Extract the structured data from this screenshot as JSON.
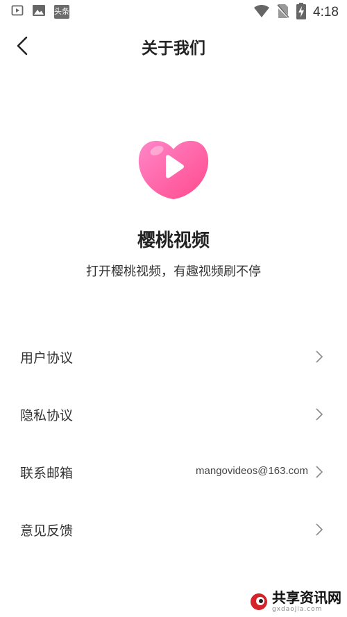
{
  "status_bar": {
    "time": "4:18",
    "left_icons": [
      "play-notification-icon",
      "image-notification-icon",
      "toutiao-notification-icon"
    ],
    "toutiao_label": "头条",
    "right_icons": [
      "wifi-icon",
      "no-sim-icon",
      "battery-charging-icon"
    ]
  },
  "header": {
    "title": "关于我们",
    "back_icon": "chevron-left-icon"
  },
  "app": {
    "name": "樱桃视频",
    "slogan": "打开樱桃视频，有趣视频刷不停",
    "logo_colors": [
      "#ff7fbf",
      "#ff4f95"
    ]
  },
  "menu": {
    "items": [
      {
        "label": "用户协议",
        "value": ""
      },
      {
        "label": "隐私协议",
        "value": ""
      },
      {
        "label": "联系邮箱",
        "value": "mangovideos@163.com"
      },
      {
        "label": "意见反馈",
        "value": ""
      }
    ]
  },
  "watermark": {
    "main": "共享资讯网",
    "sub": "gxdaojia.com"
  }
}
